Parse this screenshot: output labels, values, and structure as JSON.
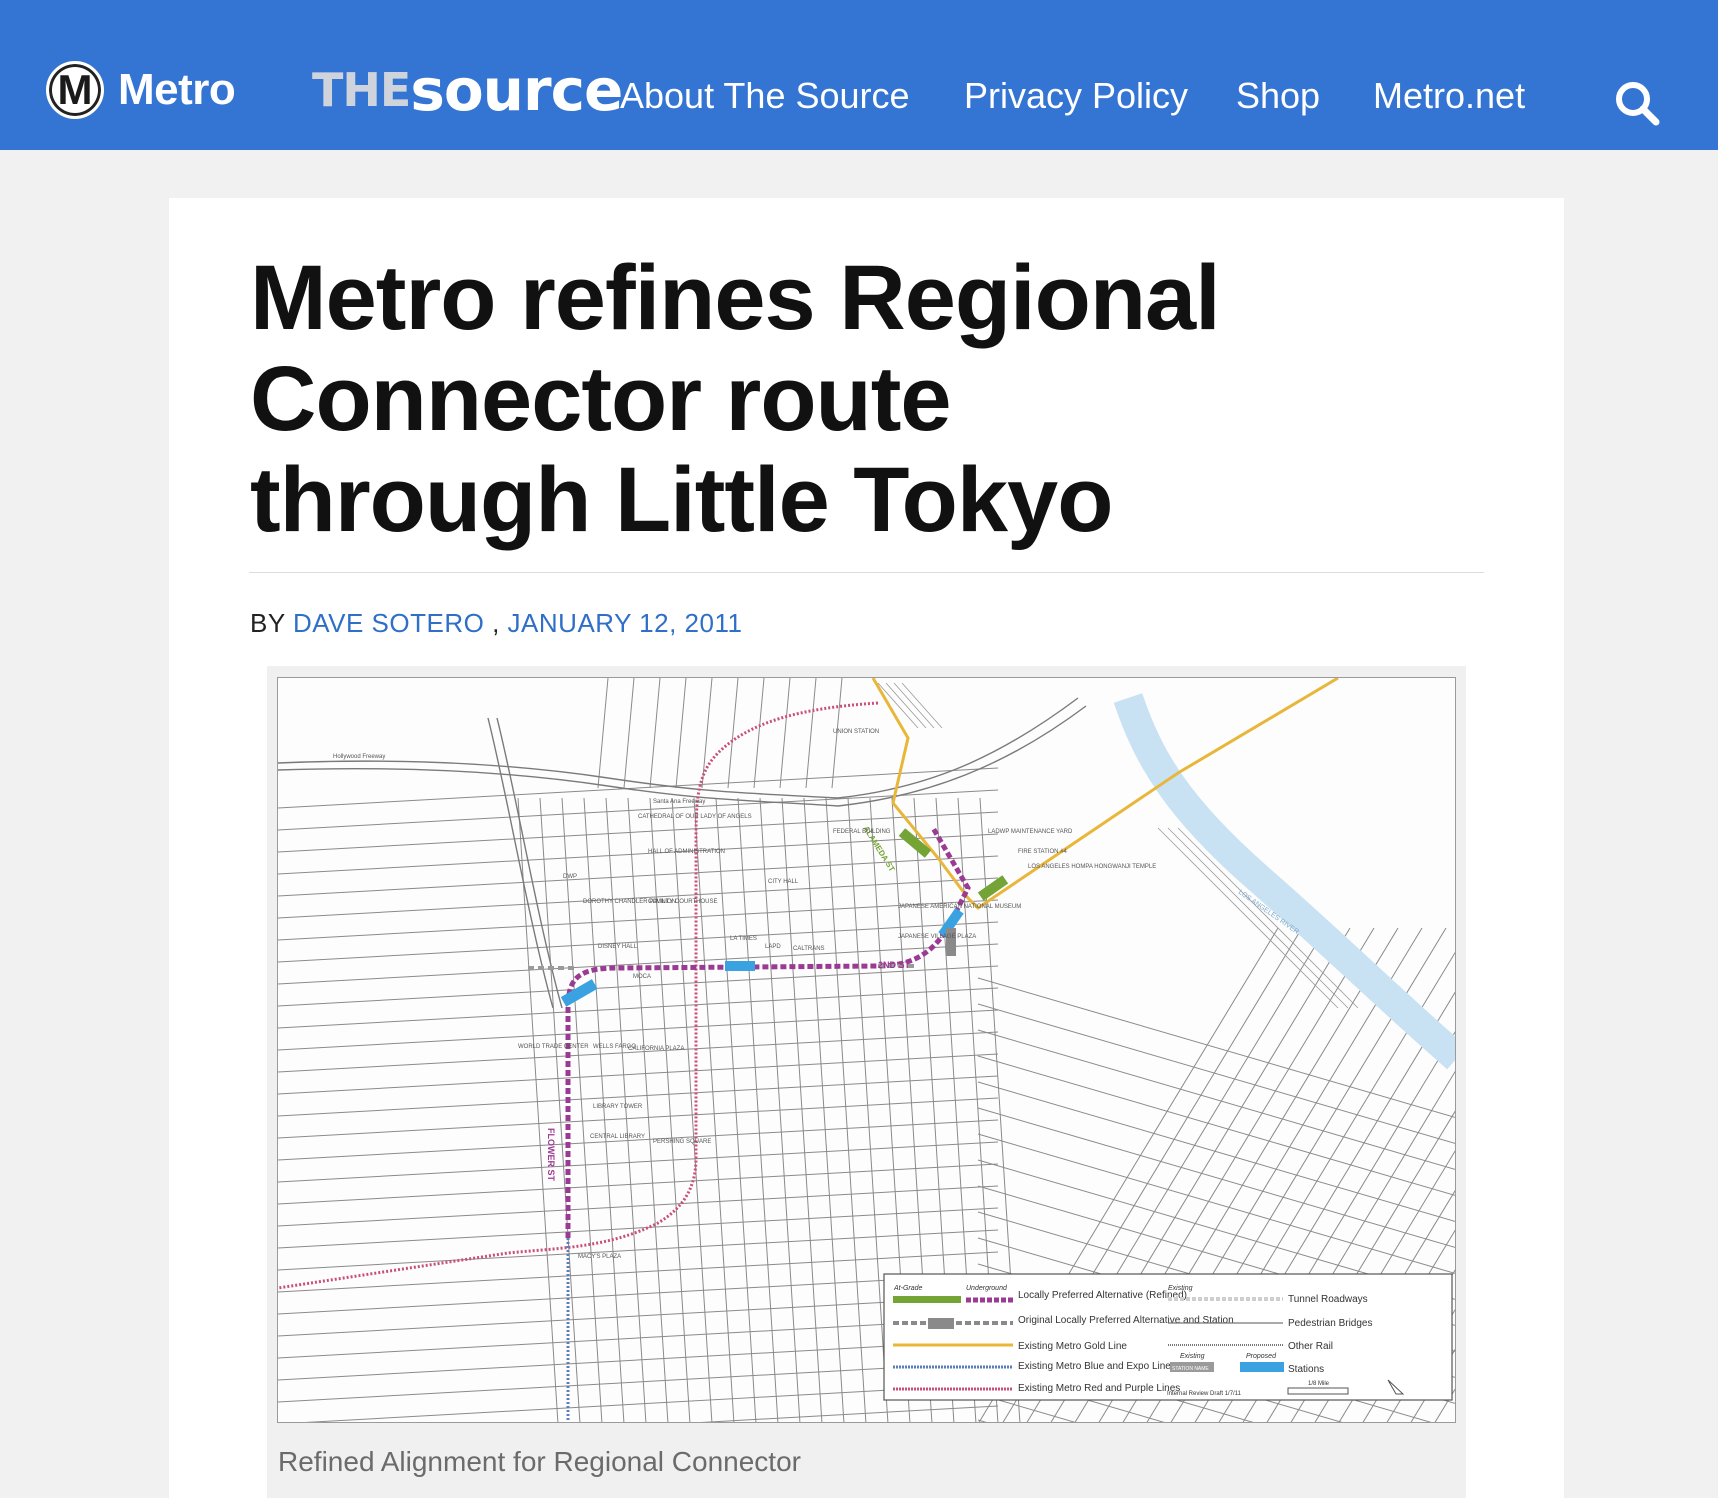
{
  "header": {
    "metro_letter": "M",
    "metro_word": "Metro",
    "the": "THE",
    "source": "source",
    "nav": [
      "About The Source",
      "Privacy Policy",
      "Shop",
      "Metro.net"
    ],
    "brand_color": "#3475d4",
    "search_icon": "search-icon"
  },
  "article": {
    "title": "Metro refines Regional Connector route through Little Tokyo",
    "by": "BY",
    "author": "DAVE SOTERO",
    "sep": ",",
    "date": "JANUARY 12, 2011",
    "link_color": "#2f6fc8"
  },
  "map": {
    "streets": [
      "2ND ST",
      "FLOWER ST",
      "ALAMEDA ST"
    ],
    "landmarks": [
      "UNION STATION",
      "DISNEY HALL",
      "MOCA",
      "CITY HALL",
      "LA TIMES",
      "LAPD",
      "CALTRANS",
      "WORLD TRADE CENTER",
      "WELLS FARGO",
      "CALIFORNIA PLAZA",
      "LIBRARY TOWER",
      "CENTRAL LIBRARY",
      "PERSHING SQUARE",
      "COUNTY COURTHOUSE",
      "DOROTHY CHANDLER PAVILION",
      "HALL OF ADMINISTRATION",
      "CATHEDRAL OF OUR LADY OF ANGELS",
      "FEDERAL BUILDING",
      "MACY'S PLAZA",
      "JAPANESE AMERICAN NATIONAL MUSEUM",
      "JAPANESE VILLAGE PLAZA",
      "LADWP MAINTENANCE YARD",
      "FIRE STATION #4",
      "LOS ANGELES HOMPA HONGWANJI TEMPLE",
      "DWP",
      "LOS ANGELES RIVER",
      "Santa Ana Freeway",
      "Hollywood Freeway"
    ],
    "legend": {
      "at_grade": "At-Grade",
      "underground": "Underground",
      "existing": "Existing",
      "proposed": "Proposed",
      "items": [
        "Locally Preferred Alternative (Refined)",
        "Original Locally Preferred Alternative and Station",
        "Existing Metro Gold Line",
        "Existing Metro Blue and Expo Lines",
        "Existing Metro Red and Purple Lines"
      ],
      "right_items": [
        "Tunnel Roadways",
        "Pedestrian Bridges",
        "Other Rail",
        "Stations"
      ],
      "station_name": "STATION NAME",
      "scale": "1/8 Mile",
      "draft": "Internal Review Draft 1/7/11"
    },
    "colors": {
      "lpa": "#9b3a93",
      "gold": "#e8b73a",
      "green": "#74a336",
      "blue_station": "#3aa2e0",
      "red_purple": "#c94f7a",
      "blue_line": "#5a7fb5"
    }
  },
  "caption": "Refined Alignment for Regional Connector"
}
